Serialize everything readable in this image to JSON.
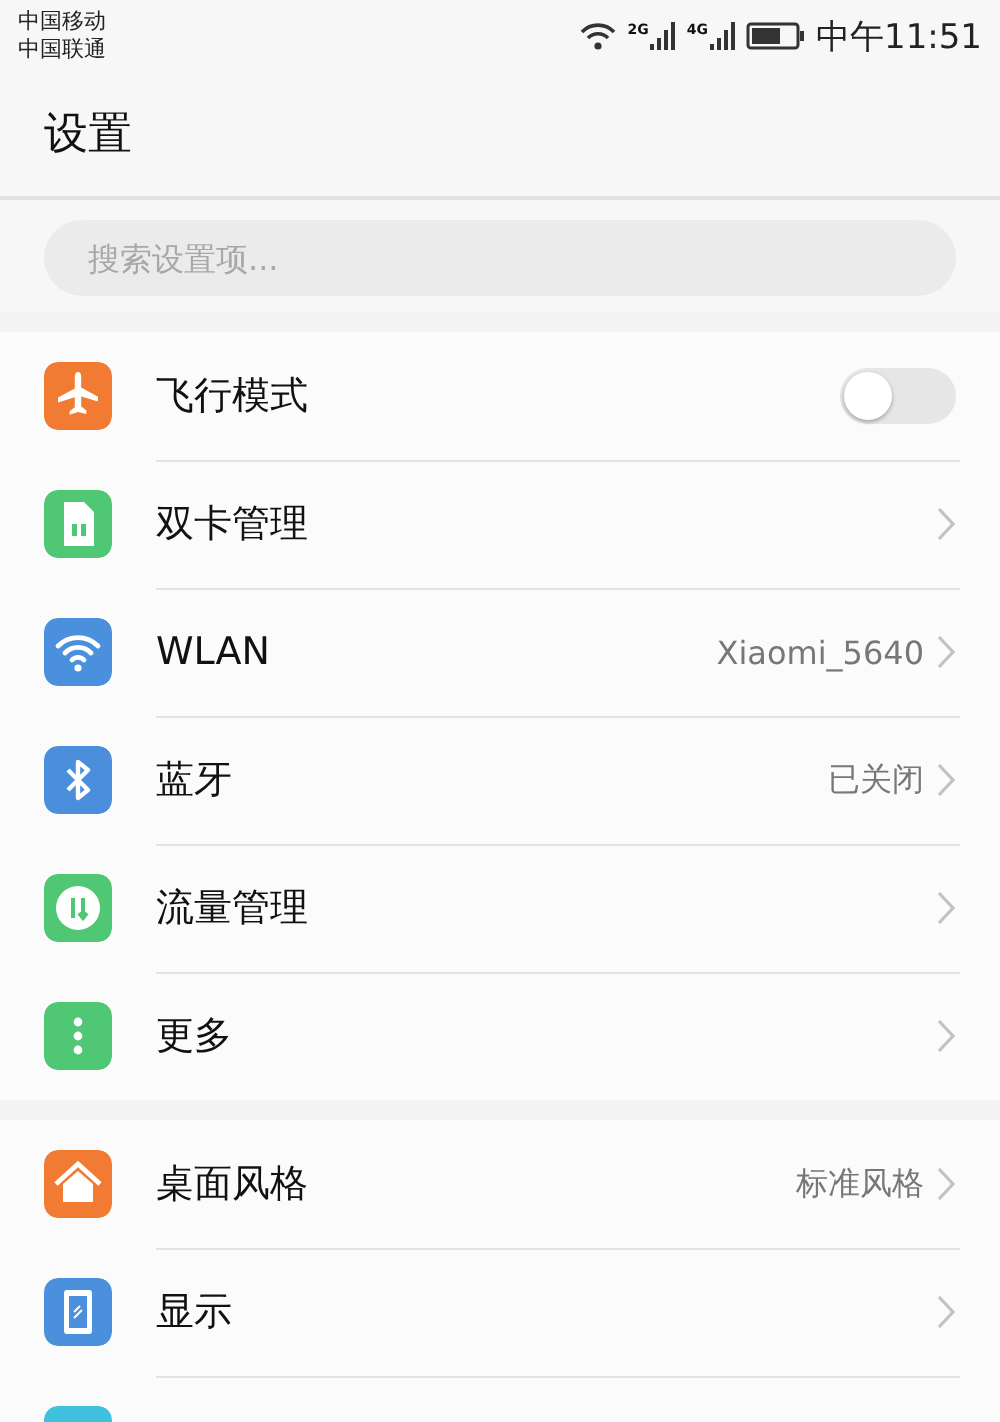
{
  "status_bar": {
    "carriers": [
      "中国移动",
      "中国联通"
    ],
    "networks": [
      "2G",
      "4G"
    ],
    "time": "中午11:51"
  },
  "title": "设置",
  "search": {
    "placeholder": "搜索设置项..."
  },
  "groups": [
    {
      "items": [
        {
          "color": "#f27b33",
          "label": "飞行模式",
          "kind": "toggle",
          "on": false
        },
        {
          "color": "#4fc775",
          "label": "双卡管理",
          "kind": "link"
        },
        {
          "color": "#4a90dc",
          "label": "WLAN",
          "kind": "link",
          "value": "Xiaomi_5640"
        },
        {
          "color": "#4a8edc",
          "label": "蓝牙",
          "kind": "link",
          "value": "已关闭"
        },
        {
          "color": "#4fc775",
          "label": "流量管理",
          "kind": "link"
        },
        {
          "color": "#4fc775",
          "label": "更多",
          "kind": "link"
        }
      ]
    },
    {
      "items": [
        {
          "color": "#f27b33",
          "label": "桌面风格",
          "kind": "link",
          "value": "标准风格"
        },
        {
          "color": "#4a90dc",
          "label": "显示",
          "kind": "link"
        },
        {
          "color": "#3fc0dc",
          "kind": "partial"
        }
      ]
    }
  ]
}
